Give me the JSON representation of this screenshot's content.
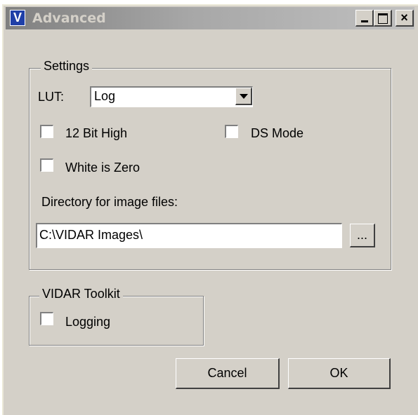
{
  "window": {
    "title": "Advanced",
    "app_icon_letter": "V",
    "minimize_glyph": "_",
    "maximize_glyph": "□",
    "close_glyph": "×"
  },
  "settings": {
    "group_label": "Settings",
    "lut_label": "LUT:",
    "lut_value": "Log",
    "twelve_bit_label": "12 Bit High",
    "twelve_bit_checked": false,
    "ds_mode_label": "DS Mode",
    "ds_mode_checked": false,
    "white_zero_label": "White is Zero",
    "white_zero_checked": false,
    "directory_label": "Directory for image files:",
    "directory_value": "C:\\VIDAR Images\\",
    "browse_label": "..."
  },
  "toolkit": {
    "group_label": "VIDAR Toolkit",
    "logging_label": "Logging",
    "logging_checked": false
  },
  "buttons": {
    "cancel": "Cancel",
    "ok": "OK"
  },
  "colors": {
    "dialog_bg": "#d4d0c8",
    "inactive_title": "#808080",
    "icon_blue": "#1f3fa8"
  }
}
